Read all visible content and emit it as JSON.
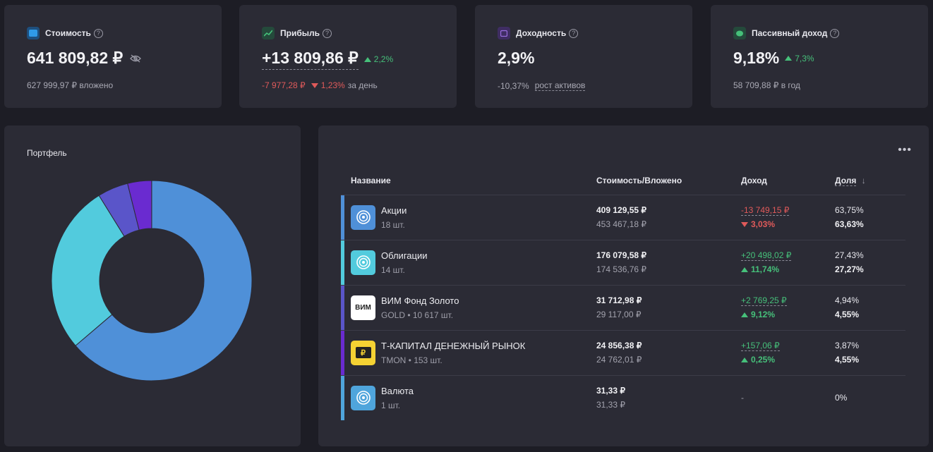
{
  "stats": [
    {
      "title": "Стоимость",
      "main": "641 809,82 ₽",
      "sub": "627 999,97 ₽ вложено",
      "icon": "wallet-icon",
      "color": "#2f7fd8"
    },
    {
      "title": "Прибыль",
      "main": "+13 809,86 ₽",
      "change": "2,2%",
      "day_value": "-7 977,28 ₽",
      "day_pct": "1,23%",
      "day_label": "за день",
      "icon": "chart-line-icon",
      "color": "#2e6b52"
    },
    {
      "title": "Доходность",
      "main": "2,9%",
      "sub_value": "-10,37%",
      "sub_label": "рост активов",
      "icon": "calendar-icon",
      "color": "#5a3f8c"
    },
    {
      "title": "Пассивный доход",
      "main": "9,18%",
      "change": "7,3%",
      "sub": "58 709,88 ₽ в год",
      "icon": "piggy-bank-icon",
      "color": "#2e6b52"
    }
  ],
  "portfolio": {
    "title": "Портфель"
  },
  "table": {
    "headers": {
      "name": "Название",
      "value": "Стоимость/Вложено",
      "income": "Доход",
      "share": "Доля"
    },
    "rows": [
      {
        "name": "Акции",
        "sub": "18 шт.",
        "value": "409 129,55 ₽",
        "invested": "453 467,18 ₽",
        "income": "-13 749,15 ₽",
        "income_pct": "3,03%",
        "dir": "down",
        "share": "63,75%",
        "share2": "63,63%",
        "color": "#4f90d8",
        "logo_bg": "#4f90d8"
      },
      {
        "name": "Облигации",
        "sub": "14 шт.",
        "value": "176 079,58 ₽",
        "invested": "174 536,76 ₽",
        "income": "+20 498,02 ₽",
        "income_pct": "11,74%",
        "dir": "up",
        "share": "27,43%",
        "share2": "27,27%",
        "color": "#52cbdd",
        "logo_bg": "#52cbdd"
      },
      {
        "name": "ВИМ Фонд Золото",
        "sub": "GOLD • 10 617 шт.",
        "value": "31 712,98 ₽",
        "invested": "29 117,00 ₽",
        "income": "+2 769,25 ₽",
        "income_pct": "9,12%",
        "dir": "up",
        "share": "4,94%",
        "share2": "4,55%",
        "color": "#5a55c9",
        "logo_bg": "#ffffff",
        "logo_text": "ВИМ"
      },
      {
        "name": "Т-КАПИТАЛ ДЕНЕЖНЫЙ РЫНОК",
        "sub": "TMON • 153 шт.",
        "value": "24 856,38 ₽",
        "invested": "24 762,01 ₽",
        "income": "+157,06 ₽",
        "income_pct": "0,25%",
        "dir": "up",
        "share": "3,87%",
        "share2": "4,55%",
        "color": "#6a2bd0",
        "logo_bg": "#f5d233",
        "logo_text": "₽"
      },
      {
        "name": "Валюта",
        "sub": "1 шт.",
        "value": "31,33 ₽",
        "invested": "31,33 ₽",
        "income": "-",
        "income_pct": "",
        "dir": "none",
        "share": "0%",
        "share2": "",
        "color": "#4fa5dc",
        "logo_bg": "#4fa5dc"
      }
    ]
  },
  "chart_data": {
    "type": "pie",
    "categories": [
      "Акции",
      "Облигации",
      "ВИМ Фонд Золото",
      "Т-КАПИТАЛ ДЕНЕЖНЫЙ РЫНОК",
      "Валюта"
    ],
    "values": [
      63.75,
      27.43,
      4.94,
      3.87,
      0.01
    ],
    "colors": [
      "#4f90d8",
      "#52cbdd",
      "#5a55c9",
      "#6a2bd0",
      "#4fa5dc"
    ]
  }
}
